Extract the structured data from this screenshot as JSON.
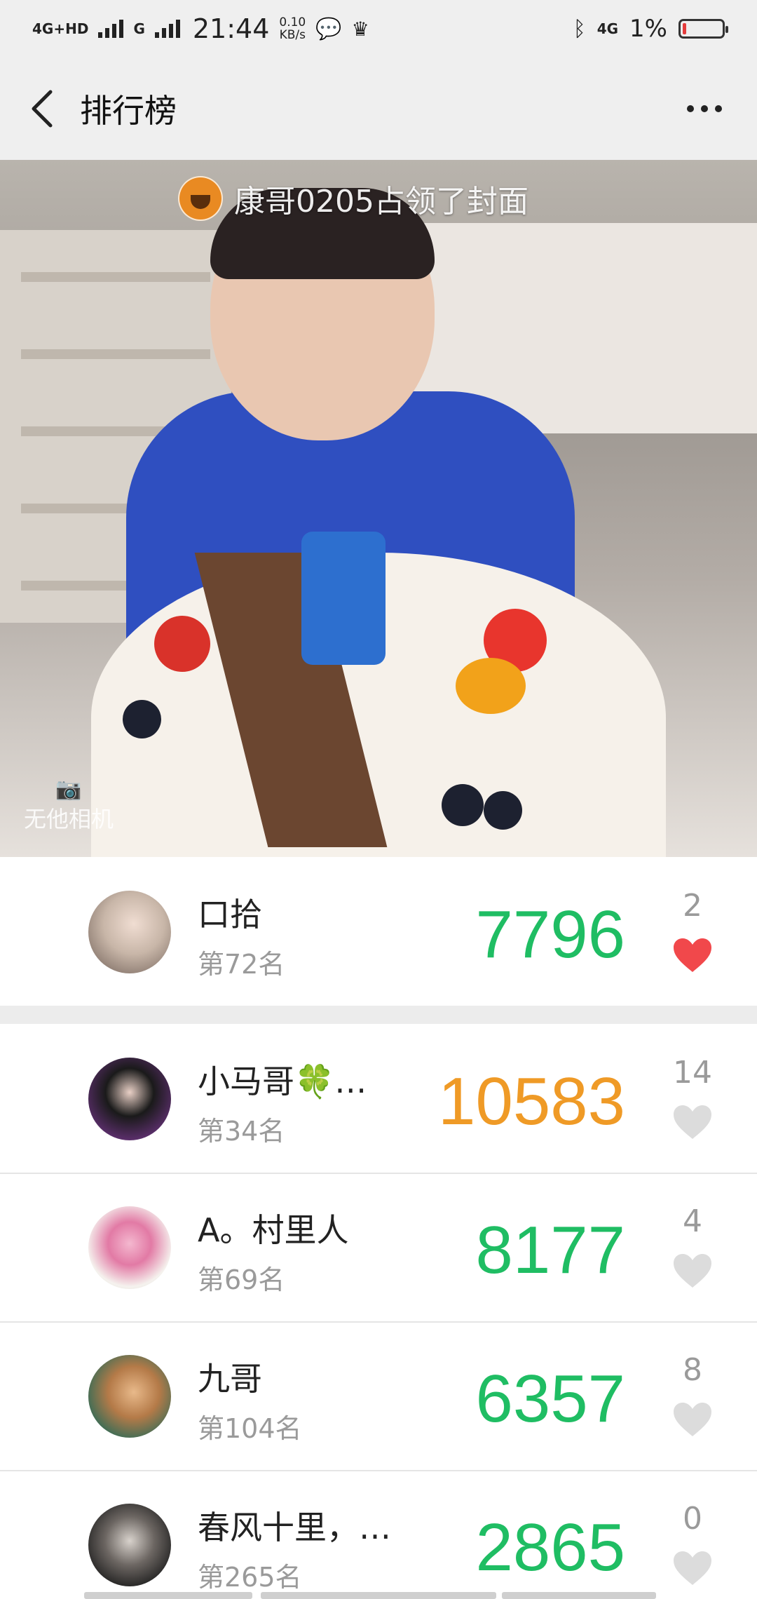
{
  "status_bar": {
    "network1": "4G+HD",
    "network2": "G",
    "time": "21:44",
    "speed_value": "0.10",
    "speed_unit": "KB/s",
    "network_right": "4G",
    "battery": "1%"
  },
  "nav": {
    "title": "排行榜"
  },
  "cover": {
    "caption": "康哥0205占领了封面",
    "watermark": "无他相机"
  },
  "my_entry": {
    "name": "口拾",
    "rank": "第72名",
    "steps": "7796",
    "likes": "2",
    "liked": true
  },
  "rankings": [
    {
      "name": "小马哥🍀…",
      "rank": "第34名",
      "steps": "10583",
      "likes": "14",
      "highlight": true
    },
    {
      "name": "A。村里人",
      "rank": "第69名",
      "steps": "8177",
      "likes": "4",
      "highlight": false
    },
    {
      "name": "九哥",
      "rank": "第104名",
      "steps": "6357",
      "likes": "8",
      "highlight": false
    },
    {
      "name": "春风十里，…",
      "rank": "第265名",
      "steps": "2865",
      "likes": "0",
      "highlight": false
    }
  ],
  "colors": {
    "steps_green": "#1fbd63",
    "steps_orange": "#ef9a26",
    "heart_red": "#f1484b",
    "heart_gray": "#dcdcdc"
  }
}
